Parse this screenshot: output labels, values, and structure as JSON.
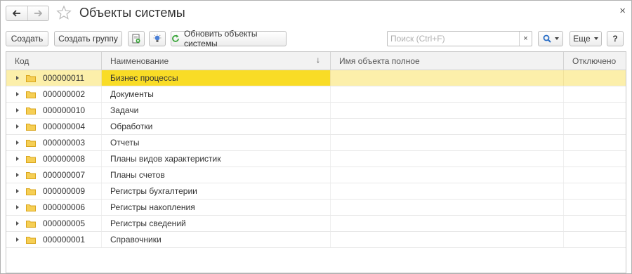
{
  "window": {
    "title": "Объекты системы",
    "close_symbol": "×"
  },
  "toolbar": {
    "create_label": "Создать",
    "create_group_label": "Создать группу",
    "refresh_label": "Обновить объекты системы",
    "search_placeholder": "Поиск (Ctrl+F)",
    "search_clear_symbol": "×",
    "more_label": "Еще",
    "help_label": "?"
  },
  "table": {
    "columns": [
      "Код",
      "Наименование",
      "Имя объекта полное",
      "Отключено"
    ],
    "sort_indicator": "↓",
    "rows": [
      {
        "code": "000000011",
        "name": "Бизнес процессы",
        "selected": true
      },
      {
        "code": "000000002",
        "name": "Документы"
      },
      {
        "code": "000000010",
        "name": "Задачи"
      },
      {
        "code": "000000004",
        "name": "Обработки"
      },
      {
        "code": "000000003",
        "name": "Отчеты"
      },
      {
        "code": "000000008",
        "name": "Планы видов характеристик"
      },
      {
        "code": "000000007",
        "name": "Планы счетов"
      },
      {
        "code": "000000009",
        "name": "Регистры бухгалтерии"
      },
      {
        "code": "000000006",
        "name": "Регистры накопления"
      },
      {
        "code": "000000005",
        "name": "Регистры сведений"
      },
      {
        "code": "000000001",
        "name": "Справочники"
      }
    ]
  },
  "colors": {
    "selected_row": "#fcefaa",
    "selected_cell": "#f9dc26",
    "folder": "#f3c53c",
    "refresh": "#3aa53a"
  }
}
